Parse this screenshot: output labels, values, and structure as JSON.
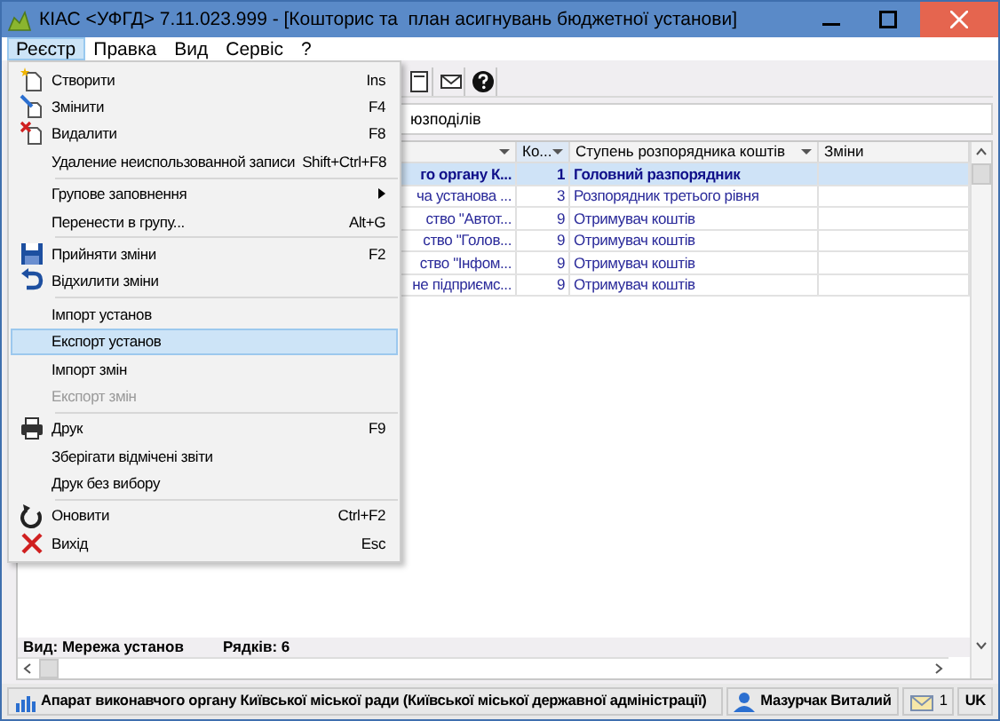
{
  "window": {
    "title": "КІАС <УФГД> 7.11.023.999 - [Кошторис та  план асигнувань бюджетної установи]"
  },
  "menu_bar": [
    {
      "label": "Реєстр",
      "selected": true
    },
    {
      "label": "Правка",
      "selected": false
    },
    {
      "label": "Вид",
      "selected": false
    },
    {
      "label": "Сервіс",
      "selected": false
    },
    {
      "label": "?",
      "selected": false
    }
  ],
  "menu": [
    {
      "kind": "item",
      "label": "Створити",
      "shortcut": "Ins",
      "disabled": false,
      "selected": false
    },
    {
      "kind": "item",
      "label": "Змінити",
      "shortcut": "F4",
      "disabled": false,
      "selected": false
    },
    {
      "kind": "item",
      "label": "Видалити",
      "shortcut": "F8",
      "disabled": false,
      "selected": false
    },
    {
      "kind": "item",
      "label": "Удаление неиспользованной записи",
      "shortcut": "Shift+Ctrl+F8",
      "disabled": false,
      "selected": false
    },
    {
      "kind": "separator"
    },
    {
      "kind": "submenu",
      "label": "Групове заповнення",
      "disabled": false,
      "selected": false
    },
    {
      "kind": "item",
      "label": "Перенести в групу...",
      "shortcut": "Alt+G",
      "disabled": false,
      "selected": false
    },
    {
      "kind": "separator"
    },
    {
      "kind": "item",
      "label": "Прийняти зміни",
      "shortcut": "F2",
      "disabled": false,
      "selected": false
    },
    {
      "kind": "item",
      "label": "Відхилити зміни",
      "disabled": false,
      "selected": false
    },
    {
      "kind": "separator"
    },
    {
      "kind": "item",
      "label": "Імпорт установ",
      "disabled": false,
      "selected": false
    },
    {
      "kind": "item",
      "label": "Експорт установ",
      "disabled": false,
      "selected": true
    },
    {
      "kind": "item",
      "label": "Імпорт змін",
      "disabled": false,
      "selected": false
    },
    {
      "kind": "item",
      "label": "Експорт змін",
      "disabled": true,
      "selected": false
    },
    {
      "kind": "separator"
    },
    {
      "kind": "item",
      "label": "Друк",
      "shortcut": "F9",
      "disabled": false,
      "selected": false
    },
    {
      "kind": "item",
      "label": "Зберігати відмічені звіти",
      "disabled": false,
      "selected": false
    },
    {
      "kind": "item",
      "label": "Друк без вибору",
      "disabled": false,
      "selected": false
    },
    {
      "kind": "separator"
    },
    {
      "kind": "item",
      "label": "Оновити",
      "shortcut": "Ctrl+F2",
      "disabled": false,
      "selected": false
    },
    {
      "kind": "item",
      "label": "Вихід",
      "shortcut": "Esc",
      "disabled": false,
      "selected": false
    }
  ],
  "panel": {
    "text": "юзподілів"
  },
  "grid": {
    "columns": [
      "Ко...",
      "Ступень розпорядника коштів",
      "Зміни"
    ],
    "rows": [
      {
        "column_1": "го органу К...",
        "code": "1",
        "degree": "Головний разпорядник",
        "selected": true
      },
      {
        "column_1": "ча установа ...",
        "code": "3",
        "degree": "Розпорядник третього рівня",
        "selected": false
      },
      {
        "column_1": "ство \"Автот...",
        "code": "9",
        "degree": "Отримувач коштів",
        "selected": false
      },
      {
        "column_1": "ство \"Голов...",
        "code": "9",
        "degree": "Отримувач коштів",
        "selected": false
      },
      {
        "column_1": "ство \"Інфом...",
        "code": "9",
        "degree": "Отримувач коштів",
        "selected": false
      },
      {
        "column_1": "не підприємс...",
        "code": "9",
        "degree": "Отримувач коштів",
        "selected": false
      }
    ]
  },
  "footer": {
    "view": "Вид: Мережа установ",
    "rows_count": "Рядків: 6"
  },
  "status_bar": {
    "organization": "Апарат виконавчого органу Київської міської ради (Київської міської державної адміністрації)",
    "user": "Мазурчак Виталий",
    "messages": "1",
    "language": "UK"
  }
}
